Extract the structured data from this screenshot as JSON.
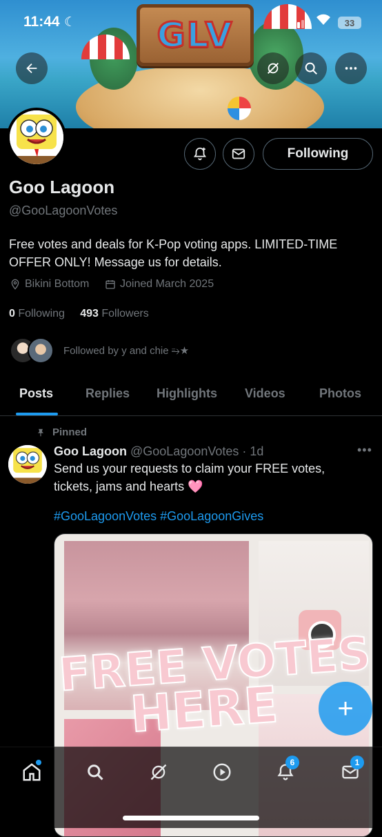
{
  "status_bar": {
    "time": "11:44",
    "battery": "33"
  },
  "banner": {
    "sign_text": "GLV"
  },
  "profile": {
    "name": "Goo Lagoon",
    "handle": "@GooLagoonVotes",
    "bio": "Free votes and deals for K-Pop voting apps. LIMITED-TIME OFFER ONLY! Message us for details.",
    "location": "Bikini Bottom",
    "joined": "Joined March 2025",
    "following_count": "0",
    "following_label": "Following",
    "followers_count": "493",
    "followers_label": "Followers",
    "followed_by": "Followed by y and chie ⥱★",
    "follow_button_label": "Following"
  },
  "tabs": [
    {
      "label": "Posts",
      "active": true
    },
    {
      "label": "Replies",
      "active": false
    },
    {
      "label": "Highlights",
      "active": false
    },
    {
      "label": "Videos",
      "active": false
    },
    {
      "label": "Photos",
      "active": false
    }
  ],
  "post": {
    "pinned_label": "Pinned",
    "author_name": "Goo Lagoon",
    "author_handle": "@GooLagoonVotes",
    "time": "· 1d",
    "text": "Send us your requests to claim your FREE votes, tickets, jams and hearts 🩷",
    "hashtags": "#GooLagoonVotes #GooLagoonGives",
    "image_text_line1": "FREE VOTES",
    "image_text_line2": "HERE"
  },
  "bottom_nav": {
    "notifications_badge": "6",
    "messages_badge": "1"
  },
  "colors": {
    "accent": "#1d9bf0",
    "background": "#000000",
    "muted": "#71767b"
  }
}
